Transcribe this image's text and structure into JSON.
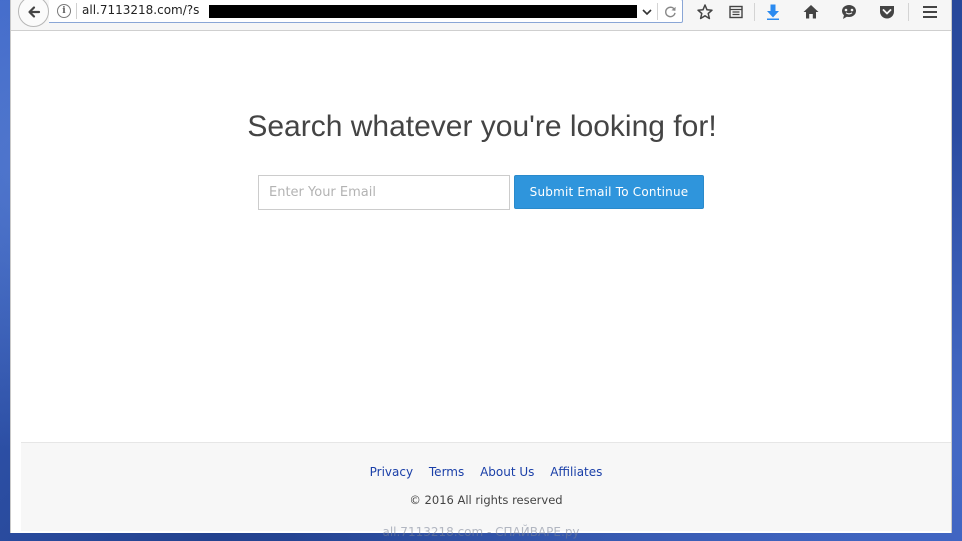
{
  "browser": {
    "url_text": "all.7113218.com/?s",
    "accent_color": "#2f95dc",
    "download_icon_color": "#2a8af0",
    "icons": [
      "back-arrow-icon",
      "info-icon",
      "dropdown-chevron-icon",
      "reload-icon",
      "bookmark-star-icon",
      "reader-list-icon",
      "download-arrow-icon",
      "home-icon",
      "chat-bubble-icon",
      "pocket-icon",
      "hamburger-menu-icon"
    ]
  },
  "page": {
    "heading": "Search whatever you're looking for!",
    "email_placeholder": "Enter Your Email",
    "email_value": "",
    "submit_label": "Submit Email To Continue"
  },
  "footer": {
    "links": [
      "Privacy",
      "Terms",
      "About Us",
      "Affiliates"
    ],
    "copyright": "© 2016 All rights reserved"
  },
  "watermark": "all.7113218.com - СПАЙВАРЕ.ру"
}
